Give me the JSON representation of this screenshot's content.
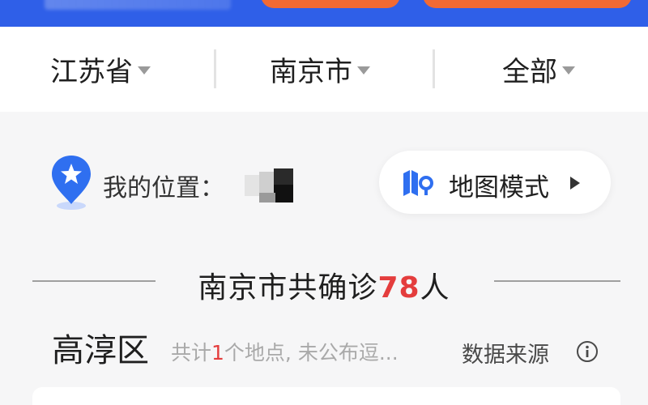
{
  "region_selector": {
    "province": "江苏省",
    "city": "南京市",
    "district": "全部"
  },
  "location": {
    "label": "我的位置：",
    "map_mode_label": "地图模式"
  },
  "summary": {
    "prefix": "南京市共确诊",
    "count": "78",
    "suffix": "人"
  },
  "district_row": {
    "name": "高淳区",
    "desc_prefix": "共计",
    "desc_count": "1",
    "desc_suffix": "个地点, 未公布逗...",
    "source_label": "数据来源"
  },
  "colors": {
    "top_bar": "#2f5fe8",
    "top_buttons": "#f26a33",
    "accent_blue": "#2f6ff0",
    "count_red": "#e43d3d"
  },
  "icons": [
    "location-pin-icon",
    "map-icon",
    "play-icon",
    "info-icon",
    "chevron-down-icon"
  ]
}
